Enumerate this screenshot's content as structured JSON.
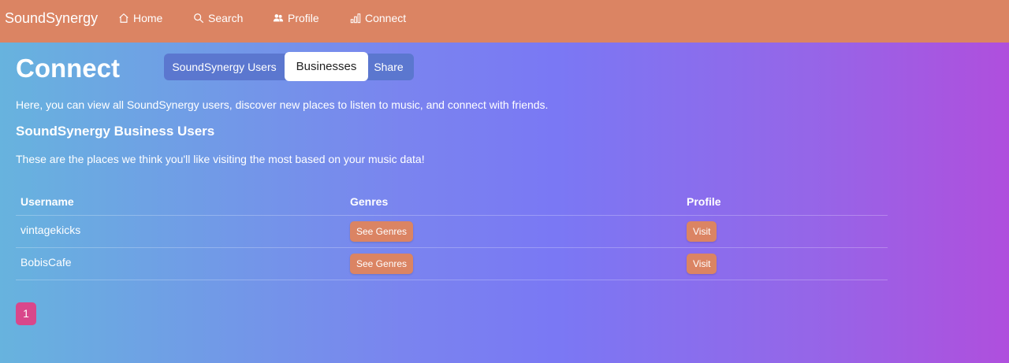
{
  "nav": {
    "brand": "SoundSynergy",
    "items": [
      {
        "label": "Home",
        "icon": "home-icon"
      },
      {
        "label": "Search",
        "icon": "search-icon"
      },
      {
        "label": "Profile",
        "icon": "users-icon"
      },
      {
        "label": "Connect",
        "icon": "bar-chart-icon"
      }
    ]
  },
  "page": {
    "title": "Connect",
    "tabs": [
      {
        "label": "SoundSynergy Users",
        "active": false
      },
      {
        "label": "Businesses",
        "active": true
      },
      {
        "label": "Share",
        "active": false
      }
    ],
    "intro": "Here, you can view all SoundSynergy users, discover new places to listen to music, and connect with friends.",
    "section_title": "SoundSynergy Business Users",
    "section_desc": "These are the places we think you'll like visiting the most based on your music data!"
  },
  "table": {
    "headers": [
      "Username",
      "Genres",
      "Profile"
    ],
    "rows": [
      {
        "username": "vintagekicks",
        "genres_button": "See Genres",
        "profile_button": "Visit"
      },
      {
        "username": "BobisCafe",
        "genres_button": "See Genres",
        "profile_button": "Visit"
      }
    ]
  },
  "pagination": {
    "current": "1"
  },
  "colors": {
    "navbar": "#db8463",
    "accent_button": "#db8463",
    "pagination": "#d9478b"
  }
}
